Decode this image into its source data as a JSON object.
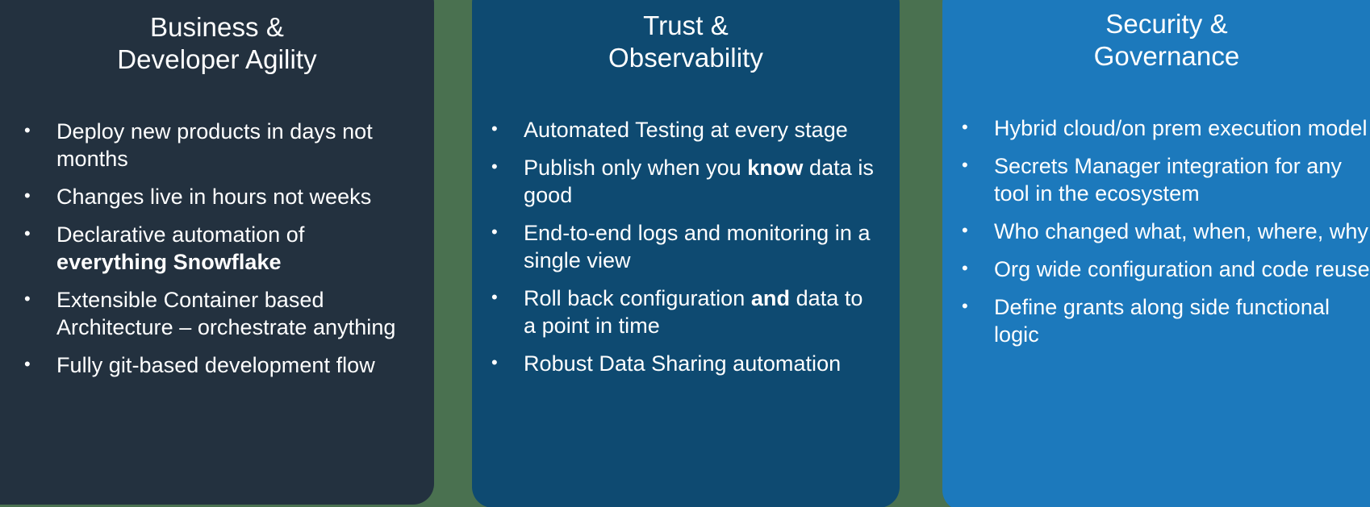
{
  "palette": {
    "background_green": "#4a7150",
    "card_agility_bg": "#23313f",
    "card_trust_bg": "#0e4a71",
    "card_security_bg": "#1c79bc",
    "text": "#ffffff"
  },
  "cards": [
    {
      "id": "business-developer-agility",
      "title": "Business &\nDeveloper Agility",
      "title_line1": "Business &",
      "title_line2": "Developer Agility",
      "bullets": [
        {
          "text": "Deploy new products in days not months",
          "bold": ""
        },
        {
          "text": "Changes live in hours not weeks",
          "bold": ""
        },
        {
          "text": "Declarative automation of ",
          "bold": "everything Snowflake",
          "after": ""
        },
        {
          "text": "Extensible Container based Architecture – orchestrate anything",
          "bold": ""
        },
        {
          "text": "Fully git-based development flow",
          "bold": ""
        }
      ]
    },
    {
      "id": "trust-observability",
      "title": "Trust &\nObservability",
      "title_line1": "Trust &",
      "title_line2": "Observability",
      "bullets": [
        {
          "text": "Automated Testing at every stage",
          "bold": ""
        },
        {
          "text": "Publish only when you ",
          "bold": "know",
          "after": " data is good"
        },
        {
          "text": "End-to-end logs and monitoring in a single view",
          "bold": ""
        },
        {
          "text": "Roll back configuration ",
          "bold": "and",
          "after": " data to a point in time"
        },
        {
          "text": "Robust Data Sharing automation",
          "bold": ""
        }
      ]
    },
    {
      "id": "security-governance",
      "title": "Security &\nGovernance",
      "title_line1": "Security &",
      "title_line2": "Governance",
      "bullets": [
        {
          "text": "Hybrid cloud/on prem execution model",
          "bold": ""
        },
        {
          "text": "Secrets Manager integration for any tool in the ecosystem",
          "bold": ""
        },
        {
          "text": "Who changed what, when, where, why",
          "bold": ""
        },
        {
          "text": "Org wide configuration and code reuse",
          "bold": ""
        },
        {
          "text": "Define grants along side functional logic",
          "bold": ""
        }
      ]
    }
  ]
}
